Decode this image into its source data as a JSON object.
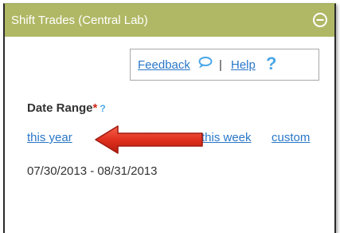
{
  "panel": {
    "title": "Shift Trades (Central Lab)",
    "collapse_icon": "minus-circle-icon"
  },
  "links": {
    "feedback": "Feedback",
    "separator": "|",
    "help": "Help",
    "help_icon_glyph": "?"
  },
  "date_range": {
    "label": "Date Range",
    "required_mark": "*",
    "info_mark": "?",
    "options": [
      "this year",
      "this week",
      "custom"
    ],
    "value": "07/30/2013 - 08/31/2013"
  },
  "colors": {
    "titlebar": "#b0b865",
    "link": "#2a77c7",
    "arrow": "#e0301e"
  }
}
